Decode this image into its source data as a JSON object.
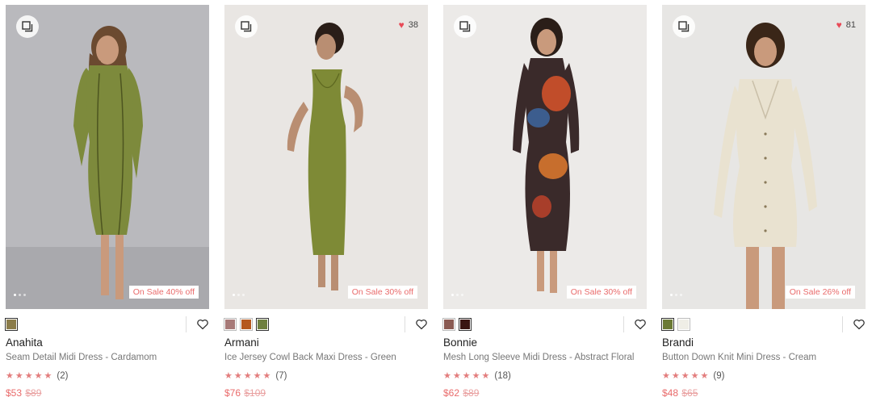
{
  "products": [
    {
      "name": "Anahita",
      "description": "Seam Detail Midi Dress - Cardamom",
      "badge": "On Sale 40% off",
      "likes": "",
      "rating_count": "(2)",
      "price_now": "$53",
      "price_was": "$89",
      "swatches": [
        "#8b7c4a"
      ],
      "background": "#b9b9bd",
      "dress_color": "#7d8a3c"
    },
    {
      "name": "Armani",
      "description": "Ice Jersey Cowl Back Maxi Dress - Green",
      "badge": "On Sale 30% off",
      "likes": "38",
      "rating_count": "(7)",
      "price_now": "$76",
      "price_was": "$109",
      "swatches": [
        "#a77a78",
        "#b5581e",
        "#6f8040"
      ],
      "background": "#e9e6e3",
      "dress_color": "#7e8a36"
    },
    {
      "name": "Bonnie",
      "description": "Mesh Long Sleeve Midi Dress - Abstract Floral",
      "badge": "On Sale 30% off",
      "likes": "",
      "rating_count": "(18)",
      "price_now": "$62",
      "price_was": "$89",
      "swatches": [
        "#8a5a52",
        "#3a1512"
      ],
      "background": "#eceae8",
      "dress_color": "#3a2a2a"
    },
    {
      "name": "Brandi",
      "description": "Button Down Knit Mini Dress - Cream",
      "badge": "On Sale 26% off",
      "likes": "81",
      "rating_count": "(9)",
      "price_now": "$48",
      "price_was": "$65",
      "swatches": [
        "#6b7a35",
        "#efeee6"
      ],
      "background": "#e7e6e4",
      "dress_color": "#e9e2d0"
    }
  ]
}
